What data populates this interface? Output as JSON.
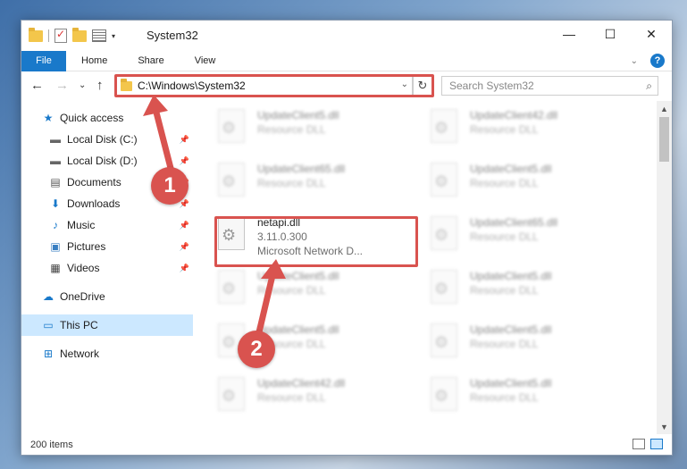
{
  "window": {
    "title": "System32"
  },
  "ribbon": {
    "tabs": [
      "File",
      "Home",
      "Share",
      "View"
    ]
  },
  "address": {
    "path": "C:\\Windows\\System32"
  },
  "search": {
    "placeholder": "Search System32"
  },
  "sidebar": {
    "items": [
      {
        "label": "Quick access",
        "icon": "star-icon"
      },
      {
        "label": "Local Disk (C:)",
        "icon": "drive-icon"
      },
      {
        "label": "Local Disk (D:)",
        "icon": "drive-icon"
      },
      {
        "label": "Documents",
        "icon": "documents-icon"
      },
      {
        "label": "Downloads",
        "icon": "download-icon"
      },
      {
        "label": "Music",
        "icon": "music-icon"
      },
      {
        "label": "Pictures",
        "icon": "pictures-icon"
      },
      {
        "label": "Videos",
        "icon": "videos-icon"
      },
      {
        "label": "OneDrive",
        "icon": "cloud-icon"
      },
      {
        "label": "This PC",
        "icon": "pc-icon"
      },
      {
        "label": "Network",
        "icon": "network-icon"
      }
    ]
  },
  "files": [
    {
      "name": "UpdateClient5.dll",
      "sub": "Resource DLL"
    },
    {
      "name": "UpdateClient42.dll",
      "sub": "Resource DLL"
    },
    {
      "name": "UpdateClient65.dll",
      "sub": "Resource DLL"
    },
    {
      "name": "UpdateClient5.dll",
      "sub": "Resource DLL"
    },
    {
      "name": "netapi.dll",
      "version": "3.11.0.300",
      "sub": "Microsoft Network D..."
    },
    {
      "name": "UpdateClient65.dll",
      "sub": "Resource DLL"
    },
    {
      "name": "UpdateClient5.dll",
      "sub": "Resource DLL"
    },
    {
      "name": "UpdateClient5.dll",
      "sub": "Resource DLL"
    },
    {
      "name": "UpdateClient5.dll",
      "sub": "Resource DLL"
    },
    {
      "name": "UpdateClient5.dll",
      "sub": "Resource DLL"
    },
    {
      "name": "UpdateClient42.dll",
      "sub": "Resource DLL"
    },
    {
      "name": "UpdateClient5.dll",
      "sub": "Resource DLL"
    }
  ],
  "status": {
    "count": "200 items"
  },
  "callouts": [
    "1",
    "2"
  ],
  "colors": {
    "accent": "#1979ca",
    "highlight": "#d9534f",
    "selected": "#cce8ff"
  }
}
